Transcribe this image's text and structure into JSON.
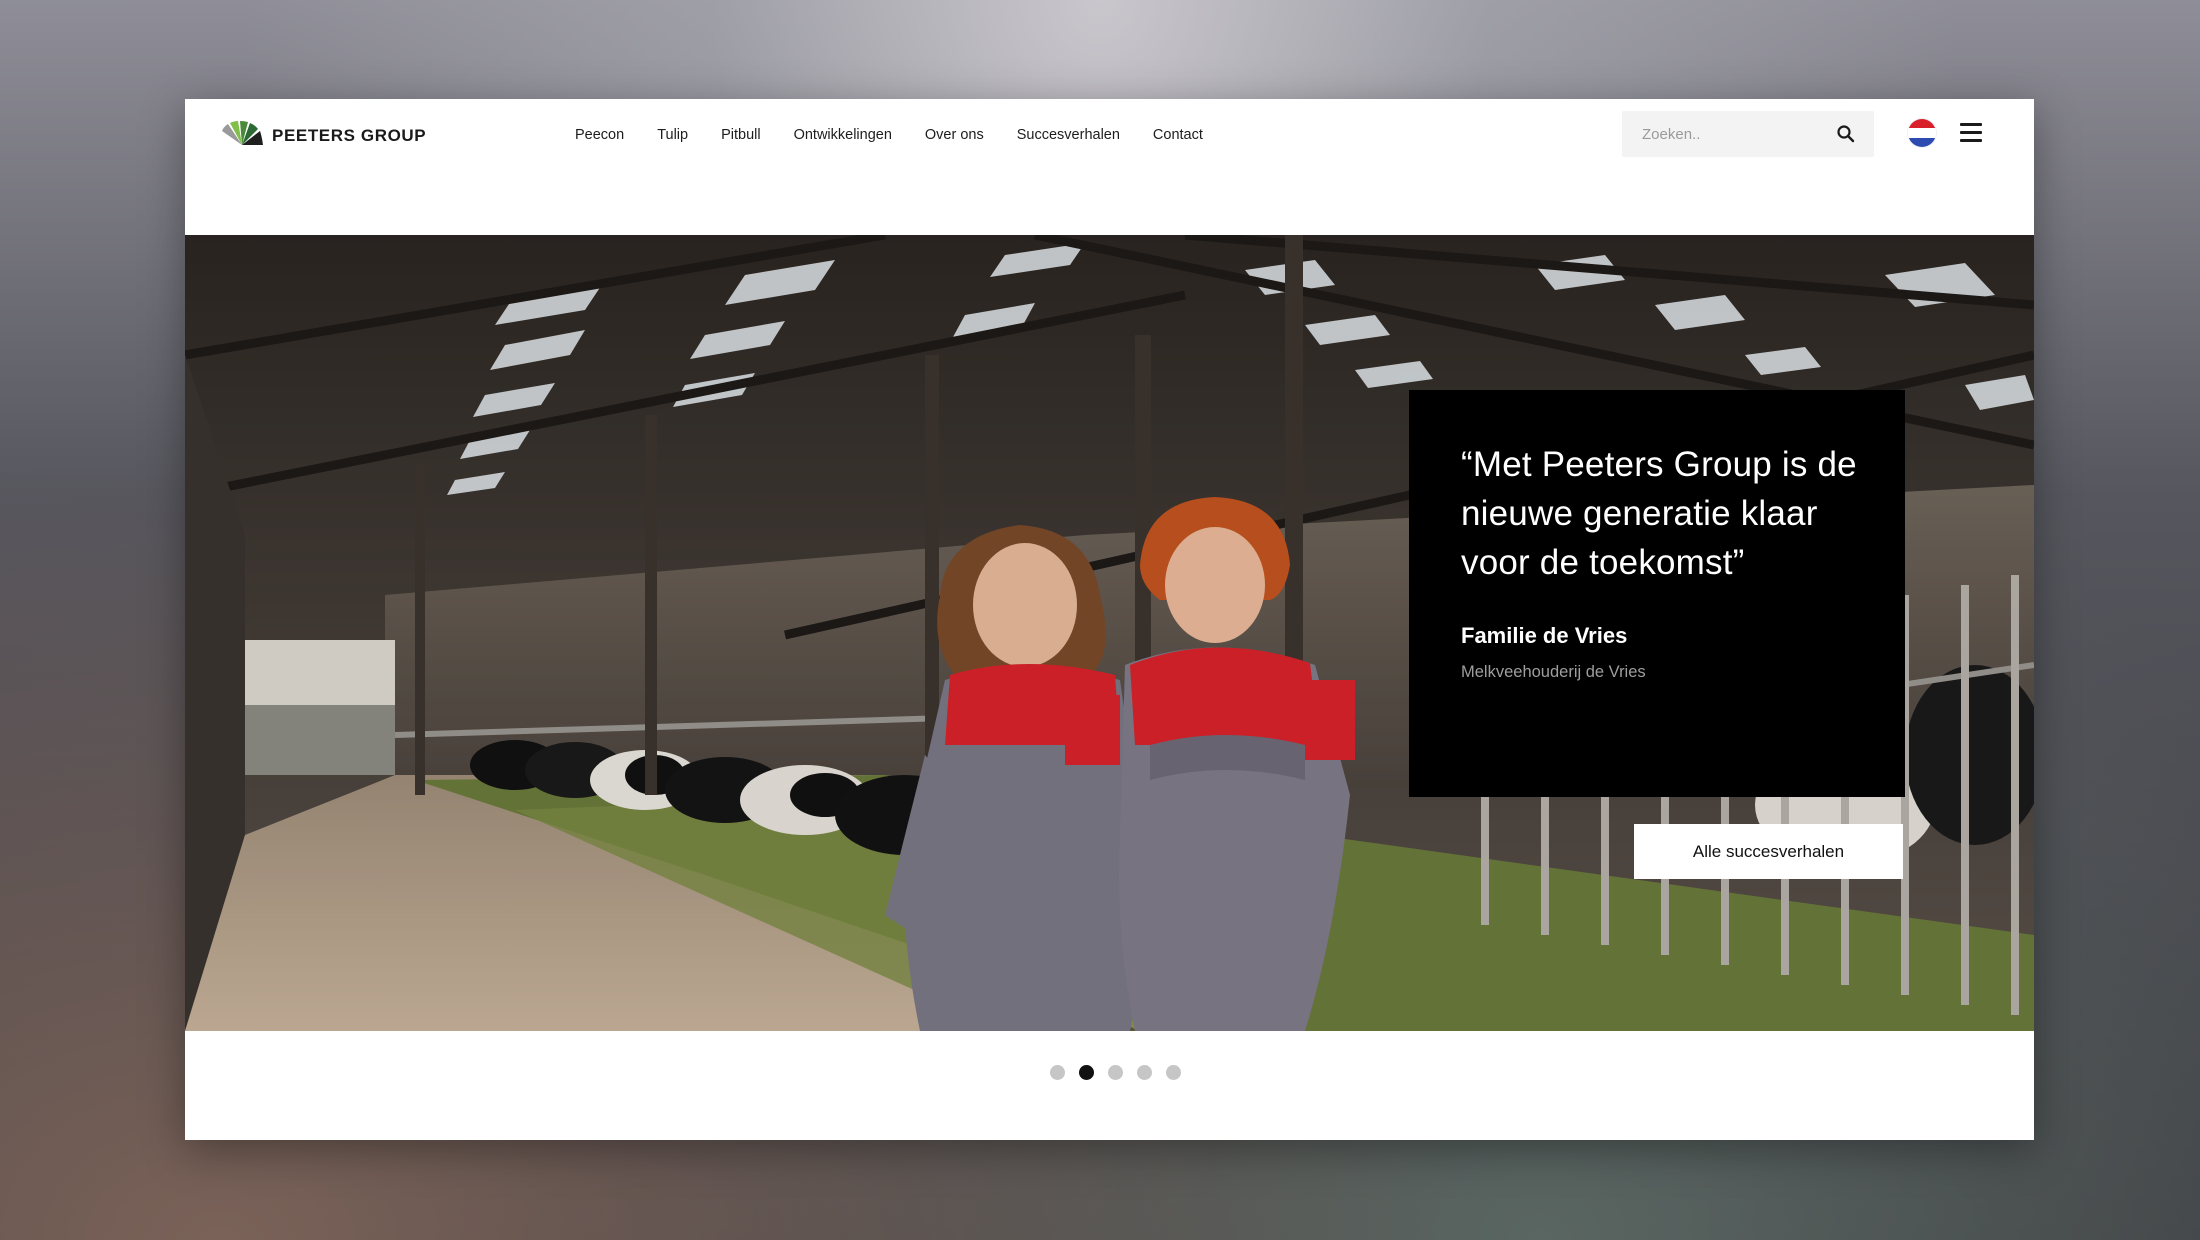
{
  "brand": {
    "name": "PEETERS GROUP"
  },
  "nav": {
    "items": [
      {
        "label": "Peecon"
      },
      {
        "label": "Tulip"
      },
      {
        "label": "Pitbull"
      },
      {
        "label": "Ontwikkelingen"
      },
      {
        "label": "Over ons"
      },
      {
        "label": "Succesverhalen"
      },
      {
        "label": "Contact"
      }
    ]
  },
  "search": {
    "placeholder": "Zoeken..",
    "icon": "search-icon"
  },
  "language": {
    "icon": "dutch-flag-icon"
  },
  "menu": {
    "icon": "hamburger-menu-icon"
  },
  "hero": {
    "quote": "“Met Peeters Group is de nieuwe generatie klaar voor de toekomst”",
    "author": "Familie de Vries",
    "role": "Melkveehouderij de Vries",
    "cta_label": "Alle succesverhalen"
  },
  "carousel": {
    "total": 5,
    "active_index": 2
  },
  "colors": {
    "quote_background": "#000000",
    "dot_active": "#111111",
    "dot_inactive": "#c6c6c6",
    "flag_red": "#d8202a",
    "flag_blue": "#2d4bb0"
  }
}
